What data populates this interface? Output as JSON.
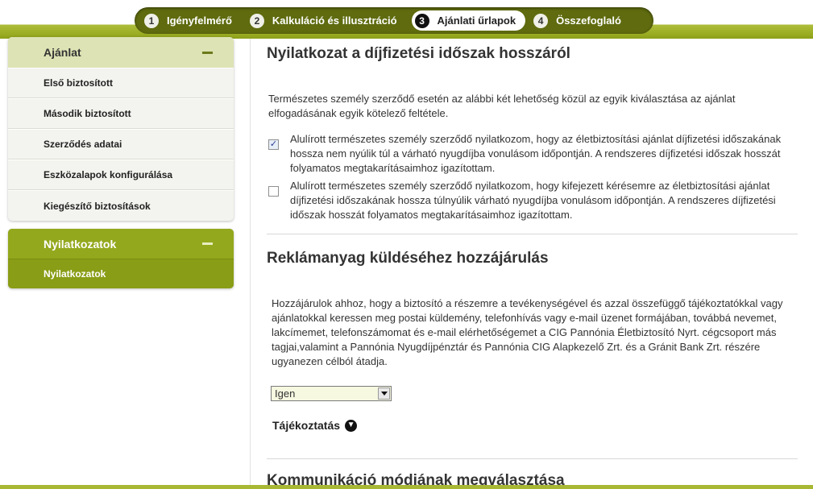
{
  "steps": [
    {
      "num": "1",
      "label": "Igényfelmérő",
      "active": false
    },
    {
      "num": "2",
      "label": "Kalkuláció és illusztráció",
      "active": false
    },
    {
      "num": "3",
      "label": "Ajánlati űrlapok",
      "active": true
    },
    {
      "num": "4",
      "label": "Összefoglaló",
      "active": false
    }
  ],
  "sidebar": {
    "ajanlat": {
      "title": "Ajánlat",
      "items": [
        "Első biztosított",
        "Második biztosított",
        "Szerződés adatai",
        "Eszközalapok konfigurálása",
        "Kiegészítő biztosítások"
      ]
    },
    "nyilatkozatok": {
      "title": "Nyilatkozatok",
      "items": [
        "Nyilatkozatok"
      ]
    }
  },
  "main": {
    "section1": {
      "title": "Nyilatkozat a díjfizetési időszak hosszáról",
      "intro": "Természetes személy szerződő esetén az alábbi két lehetőség közül az egyik kiválasztása az ajánlat elfogadásának egyik kötelező feltétele.",
      "option1": {
        "checked": true,
        "text": "Alulírott természetes személy szerződő nyilatkozom, hogy az életbiztosítási ajánlat díjfizetési időszakának hossza nem nyúlik túl a várható nyugdíjba vonulásom időpontján. A rendszeres díjfizetési időszak hosszát folyamatos megtakarításaimhoz igazítottam."
      },
      "option2": {
        "checked": false,
        "text": "Alulírott természetes személy szerződő nyilatkozom, hogy kifejezett kérésemre az életbiztosítási ajánlat díjfizetési időszakának hossza túlnyúlik várható nyugdíjba vonulásom időpontján. A rendszeres díjfizetési időszak hosszát folyamatos megtakarításaimhoz igazítottam."
      }
    },
    "section2": {
      "title": "Reklámanyag küldéséhez hozzájárulás",
      "text": "Hozzájárulok ahhoz, hogy a biztosító a részemre a tevékenységével és azzal összefüggő tájékoztatókkal vagy ajánlatokkal keressen meg postai küldemény, telefonhívás vagy e-mail üzenet formájában, továbbá nevemet, lakcímemet, telefonszámomat és e-mail elérhetőségemet a CIG Pannónia Életbiztosító Nyrt. cégcsoport más tagjai,valamint a Pannónia Nyugdíjpénztár és Pannónia CIG Alapkezelő Zrt. és a Gránit Bank Zrt. részére ugyanezen célból átadja.",
      "select_value": "Igen",
      "info_label": "Tájékoztatás"
    },
    "section3": {
      "title": "Kommunikáció módjának megválasztása"
    }
  }
}
